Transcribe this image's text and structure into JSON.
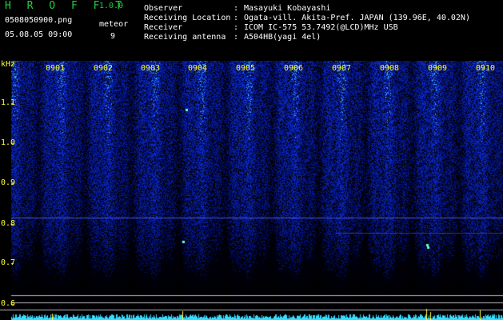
{
  "app": {
    "name": "H R O F F T",
    "version": "1.0.0"
  },
  "file": {
    "name": "0508050900.png",
    "datetime": "05.08.05 09:00",
    "meteor_label": "meteor",
    "meteor_count": "9"
  },
  "station": [
    {
      "key": "Observer",
      "sep": ":",
      "value": "Masayuki Kobayashi"
    },
    {
      "key": "Receiving Location",
      "sep": ":",
      "value": "Ogata-vill. Akita-Pref. JAPAN (139.96E, 40.02N)"
    },
    {
      "key": "Receiver",
      "sep": ":",
      "value": "ICOM IC-575 53.7492(@LCD)MHz USB"
    },
    {
      "key": "Receiving antenna",
      "sep": ":",
      "value": "A504HB(yagi 4el)"
    }
  ],
  "axis": {
    "unit": "kHz",
    "ticks": [
      "1.1",
      "1.0",
      "0.9",
      "0.8",
      "0.7",
      "0.6"
    ]
  },
  "hours": [
    "0901",
    "0902",
    "0903",
    "0904",
    "0905",
    "0906",
    "0907",
    "0908",
    "0909",
    "0910"
  ],
  "colors": {
    "background": "#000000",
    "spectrogram_blue": "#1a2fd0",
    "title_green": "#22cc44",
    "label_yellow": "#ffff33",
    "baseline_cyan": "#33ddff"
  }
}
